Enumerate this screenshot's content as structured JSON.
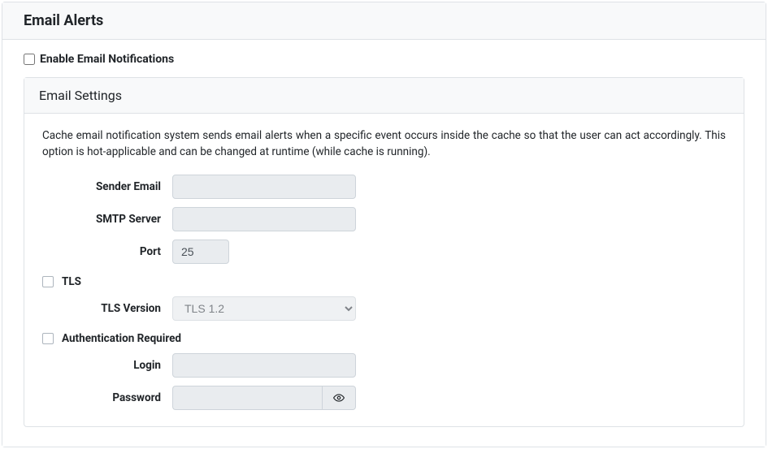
{
  "header": {
    "title": "Email Alerts"
  },
  "enable": {
    "label": "Enable Email Notifications",
    "checked": false
  },
  "panel": {
    "title": "Email Settings",
    "description": "Cache email notification system sends email alerts when a specific event occurs inside the cache so that the user can act accordingly. This option is hot-applicable and can be changed at runtime (while cache is running).",
    "fields": {
      "sender_email": {
        "label": "Sender Email",
        "value": ""
      },
      "smtp_server": {
        "label": "SMTP Server",
        "value": ""
      },
      "port": {
        "label": "Port",
        "value": "25"
      },
      "tls": {
        "label": "TLS",
        "checked": false
      },
      "tls_version": {
        "label": "TLS Version",
        "value": "TLS 1.2",
        "options": [
          "TLS 1.2"
        ]
      },
      "auth_required": {
        "label": "Authentication Required",
        "checked": false
      },
      "login": {
        "label": "Login",
        "value": ""
      },
      "password": {
        "label": "Password",
        "value": ""
      }
    }
  }
}
